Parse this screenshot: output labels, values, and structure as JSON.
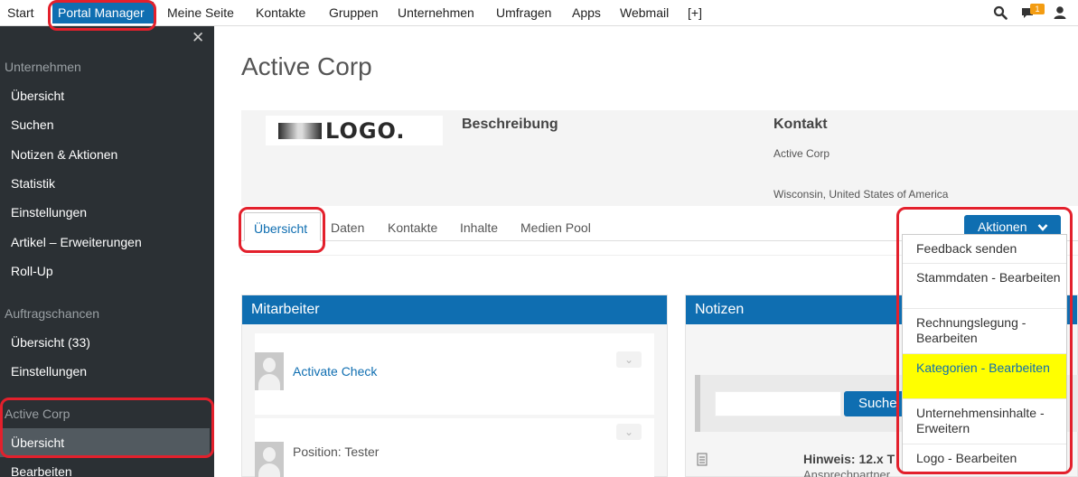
{
  "topnav": {
    "items": [
      "Start",
      "Portal Manager",
      "Meine Seite",
      "Kontakte",
      "Gruppen",
      "Unternehmen",
      "Umfragen",
      "Apps",
      "Webmail",
      "[+]"
    ],
    "message_badge": "1",
    "icons": [
      "search-icon",
      "message-icon",
      "user-icon"
    ]
  },
  "sidebar": {
    "close": "✕",
    "sections": [
      {
        "title": "Unternehmen",
        "items": [
          "Übersicht",
          "Suchen",
          "Notizen & Aktionen",
          "Statistik",
          "Einstellungen",
          "Artikel – Erweiterungen",
          "Roll-Up"
        ]
      },
      {
        "title": "Auftragschancen",
        "items": [
          "Übersicht (33)",
          "Einstellungen"
        ]
      },
      {
        "title": "Active Corp",
        "items": [
          "Übersicht",
          "Bearbeiten"
        ]
      }
    ]
  },
  "company": {
    "title": "Active Corp",
    "logo_text": "LOGO.",
    "description_label": "Beschreibung",
    "contact_label": "Kontakt",
    "contact_name": "Active Corp",
    "contact_location": "Wisconsin, United States of America"
  },
  "tabs": [
    "Übersicht",
    "Daten",
    "Kontakte",
    "Inhalte",
    "Medien Pool"
  ],
  "actions": {
    "button": "Aktionen",
    "menu": [
      "Feedback senden",
      "Stammdaten - Bearbeiten",
      "Rechnungslegung - Bearbeiten",
      "Kategorien - Bearbeiten",
      "Unternehmensinhalte - Erweitern",
      "Logo - Bearbeiten"
    ]
  },
  "mitarbeiter": {
    "title": "Mitarbeiter",
    "entries": [
      "Activate Check",
      "Position: Tester"
    ]
  },
  "notizen": {
    "title": "Notizen",
    "search_button": "Suche",
    "hint": "Hinweis: 12.x T",
    "hint_sub": "Ansprechpartner"
  },
  "colors": {
    "brand": "#0f6eb1",
    "highlight": "#ffff00",
    "annotation": "#e3202c"
  }
}
